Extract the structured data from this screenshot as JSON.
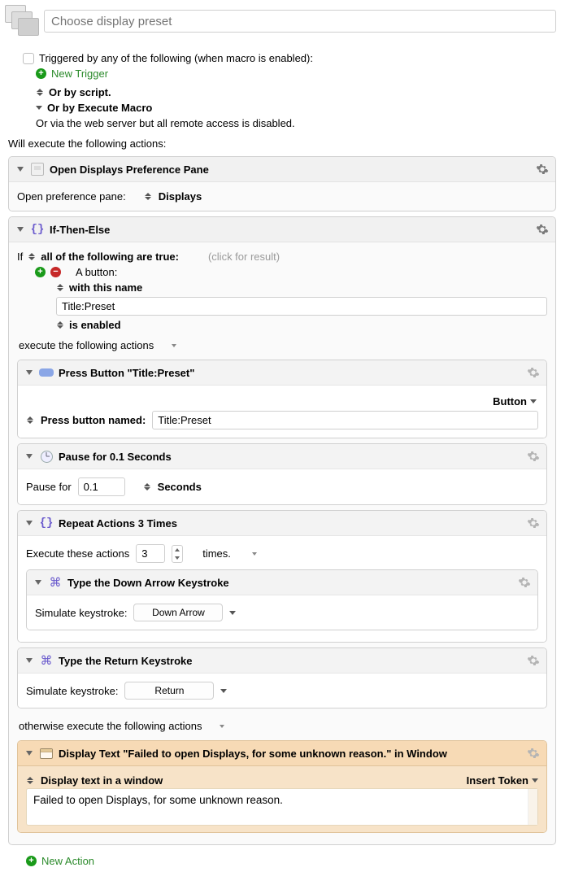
{
  "header": {
    "title_placeholder": "Choose display preset"
  },
  "trigger": {
    "label": "Triggered by any of the following (when macro is enabled):",
    "new_trigger": "New Trigger",
    "or_script": "Or by script.",
    "or_execute_macro": "Or by Execute Macro",
    "web_server": "Or via the web server but all remote access is disabled."
  },
  "actions_intro": "Will execute the following actions:",
  "action1": {
    "title": "Open Displays Preference Pane",
    "row_label": "Open preference pane:",
    "pane": "Displays"
  },
  "ifthen": {
    "title": "If-Then-Else",
    "if_label": "If",
    "all_true": "all of the following are true:",
    "click_for_result": "(click for result)",
    "a_button": "A button:",
    "with_this_name": "with this name",
    "name_value": "Title:Preset",
    "is_enabled": "is enabled",
    "execute_label": "execute the following actions",
    "otherwise_label": "otherwise execute the following actions"
  },
  "press": {
    "title": "Press Button \"Title:Preset\"",
    "button_menu": "Button",
    "row_label": "Press button named:",
    "value": "Title:Preset"
  },
  "pause": {
    "title": "Pause for 0.1 Seconds",
    "row_label": "Pause for",
    "value": "0.1",
    "unit": "Seconds"
  },
  "repeat": {
    "title": "Repeat Actions 3 Times",
    "row_label": "Execute these actions",
    "count": "3",
    "times_label": "times."
  },
  "type_down": {
    "title": "Type the Down Arrow Keystroke",
    "row_label": "Simulate keystroke:",
    "key": "Down Arrow"
  },
  "type_return": {
    "title": "Type the Return Keystroke",
    "row_label": "Simulate keystroke:",
    "key": "Return"
  },
  "display_text": {
    "title": "Display Text \"Failed to open Displays, for some unknown reason.\" in Window",
    "mode": "Display text in a window",
    "insert_token": "Insert Token",
    "body": "Failed to open Displays, for some unknown reason."
  },
  "footer": {
    "new_action": "New Action"
  }
}
